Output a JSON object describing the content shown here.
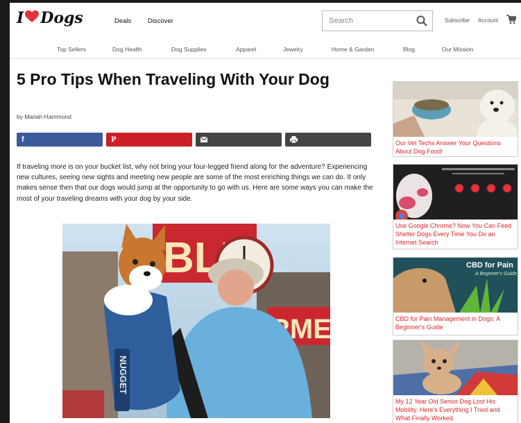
{
  "header": {
    "logo_left": "I",
    "logo_right": "Dogs",
    "nav": [
      "Deals",
      "Discover"
    ],
    "search_placeholder": "Search",
    "links": [
      "Subscribe",
      "Account"
    ]
  },
  "subnav": [
    "Top Sellers",
    "Dog Health",
    "Dog Supplies",
    "Apparel",
    "Jewelry",
    "Home & Garden",
    "Blog",
    "Our Mission"
  ],
  "article": {
    "title": "5 Pro Tips When Traveling With Your Dog",
    "byline": "by Mariah Hammond",
    "share": {
      "facebook": "f",
      "pinterest": "P"
    },
    "intro": "If traveling more is on your bucket list, why not bring your four-legged friend along for the adventure? Experiencing new cultures, seeing new sights and meeting new people are some of the most enriching things we can do. It only makes sense then that our dogs would jump at the opportunity to go with us.  Here are some ways you can make the most of your traveling dreams with your dog by your side.",
    "photo": {
      "sign_text": "BLIC",
      "market_text": "RMER",
      "backpack_tag": "NUGGET"
    }
  },
  "sidebar": [
    {
      "caption": "Our Vet Techs Answer Your Questions About Dog Food!"
    },
    {
      "caption": "Use Google Chrome? Now You Can Feed Shelter Dogs Every Time You Do an Internet Search"
    },
    {
      "caption": "CBD for Pain Management in Dogs: A Beginner's Guide",
      "overlay_title": "CBD for Pain",
      "overlay_sub": "A Beginner's Guide"
    },
    {
      "caption": "My 12 Year Old Senior Dog Lost His Mobility. Here's Everything I Tried and What Finally Worked."
    }
  ],
  "colors": {
    "accent": "#d7262e",
    "facebook": "#3b5a9a",
    "pinterest": "#cb2027",
    "dark_share": "#444444"
  }
}
